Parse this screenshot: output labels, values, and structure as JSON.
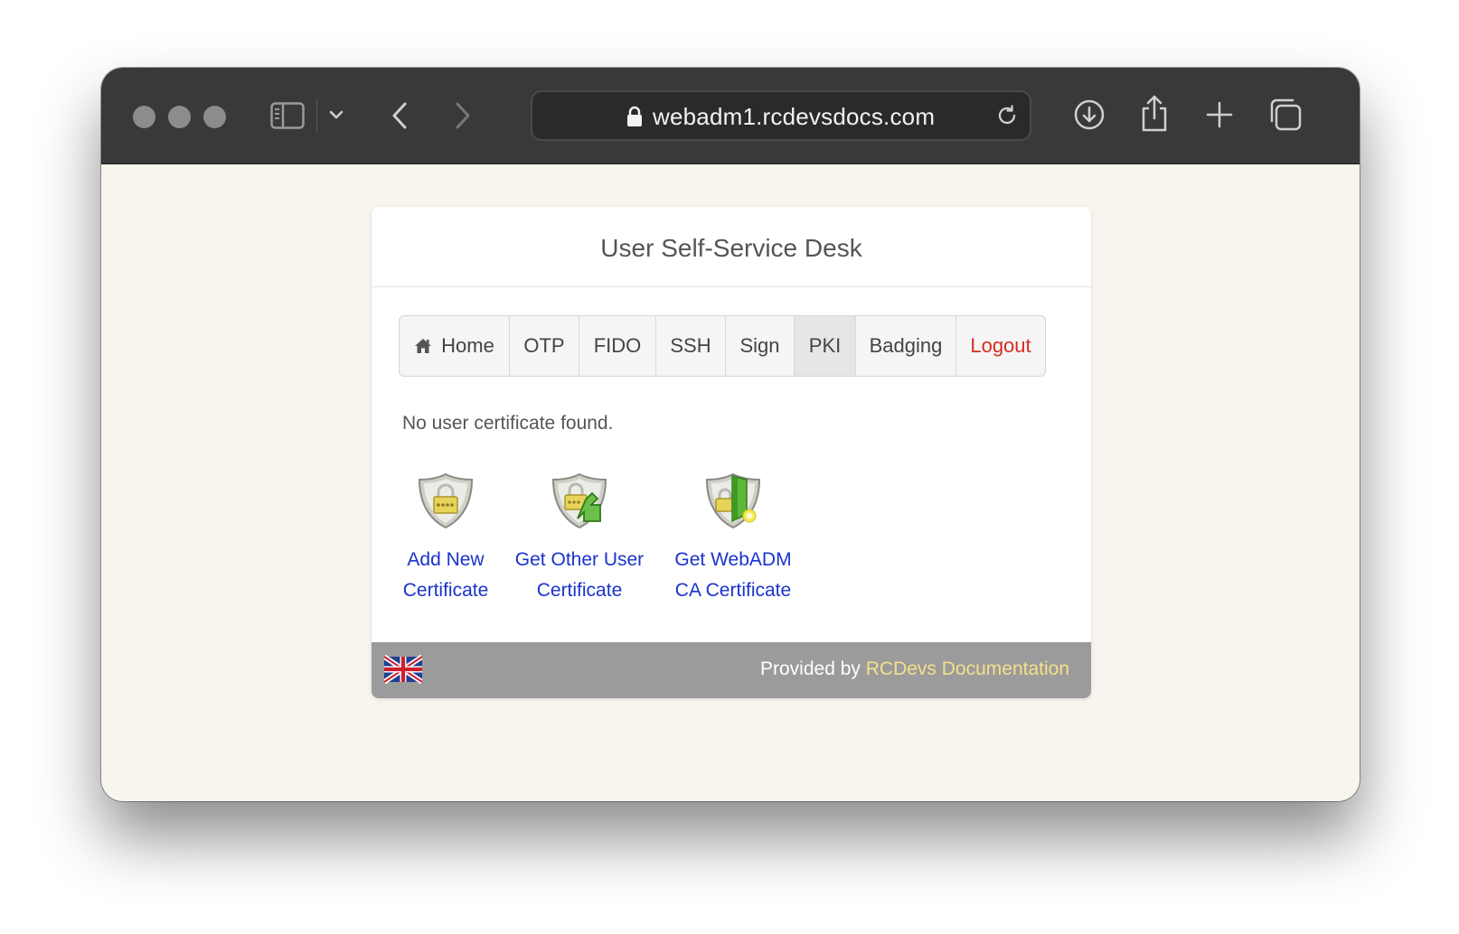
{
  "browser": {
    "url": "webadm1.rcdevsdocs.com",
    "icons": {
      "traffic_lights": [
        "close-dot",
        "minimize-dot",
        "zoom-dot"
      ],
      "sidebar": "sidebar-icon",
      "chevron": "chevron-down-icon",
      "back": "chevron-left-icon",
      "forward": "chevron-right-icon",
      "lock": "lock-icon",
      "reload": "reload-icon",
      "download": "download-icon",
      "share": "share-icon",
      "new_tab": "plus-icon",
      "tabs": "tabs-overview-icon"
    }
  },
  "page": {
    "title": "User Self-Service Desk",
    "nav": [
      {
        "label": "Home",
        "icon": "home-icon"
      },
      {
        "label": "OTP"
      },
      {
        "label": "FIDO"
      },
      {
        "label": "SSH"
      },
      {
        "label": "Sign"
      },
      {
        "label": "PKI",
        "active": true
      },
      {
        "label": "Badging"
      },
      {
        "label": "Logout",
        "color": "#d62d1f"
      }
    ],
    "message": "No user certificate found.",
    "actions": [
      {
        "line1": "Add New",
        "line2": "Certificate",
        "icon": "certificate-shield-icon"
      },
      {
        "line1": "Get Other User",
        "line2": "Certificate",
        "icon": "certificate-download-icon"
      },
      {
        "line1": "Get WebADM",
        "line2": "CA Certificate",
        "icon": "ca-certificate-icon"
      }
    ],
    "footer": {
      "flag": "uk-flag-icon",
      "provided_by": "Provided by",
      "link": "RCDevs Documentation"
    }
  },
  "colors": {
    "titlebar": "#393939",
    "page_bg": "#f8f5ee",
    "link": "#1a33cc",
    "logout": "#d62d1f",
    "footer_bg": "#9b9b9b",
    "footer_link": "#f5e08a"
  }
}
